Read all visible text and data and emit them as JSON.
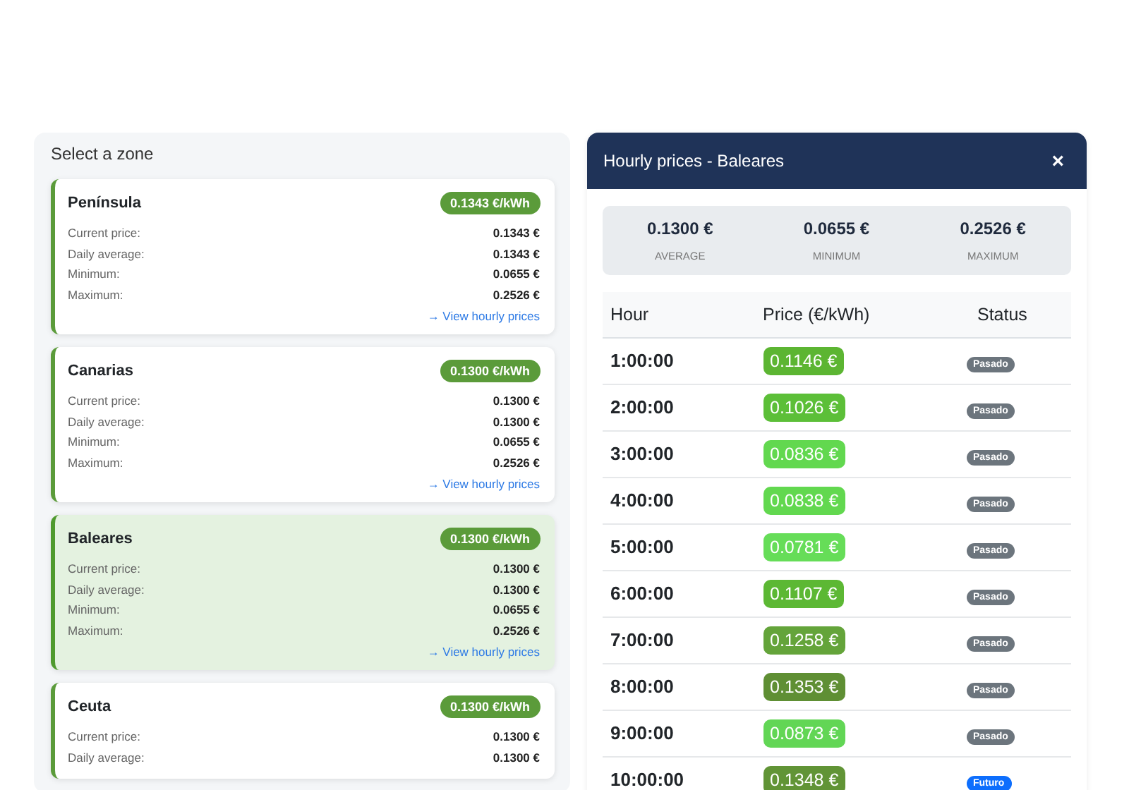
{
  "zones": {
    "title": "Select a zone",
    "cards": [
      {
        "name": "Península",
        "badge": "0.1343 €/kWh",
        "selected": false,
        "rows": [
          {
            "label": "Current price:",
            "value": "0.1343 €"
          },
          {
            "label": "Daily average:",
            "value": "0.1343 €"
          },
          {
            "label": "Minimum:",
            "value": "0.0655 €"
          },
          {
            "label": "Maximum:",
            "value": "0.2526 €"
          }
        ],
        "link": "→ View hourly prices"
      },
      {
        "name": "Canarias",
        "badge": "0.1300 €/kWh",
        "selected": false,
        "rows": [
          {
            "label": "Current price:",
            "value": "0.1300 €"
          },
          {
            "label": "Daily average:",
            "value": "0.1300 €"
          },
          {
            "label": "Minimum:",
            "value": "0.0655 €"
          },
          {
            "label": "Maximum:",
            "value": "0.2526 €"
          }
        ],
        "link": "→ View hourly prices"
      },
      {
        "name": "Baleares",
        "badge": "0.1300 €/kWh",
        "selected": true,
        "rows": [
          {
            "label": "Current price:",
            "value": "0.1300 €"
          },
          {
            "label": "Daily average:",
            "value": "0.1300 €"
          },
          {
            "label": "Minimum:",
            "value": "0.0655 €"
          },
          {
            "label": "Maximum:",
            "value": "0.2526 €"
          }
        ],
        "link": "→ View hourly prices"
      },
      {
        "name": "Ceuta",
        "badge": "0.1300 €/kWh",
        "selected": false,
        "rows": [
          {
            "label": "Current price:",
            "value": "0.1300 €"
          },
          {
            "label": "Daily average:",
            "value": "0.1300 €"
          }
        ]
      }
    ]
  },
  "modal": {
    "title": "Hourly prices - Baleares",
    "close": "×",
    "stats": [
      {
        "value": "0.1300 €",
        "label": "AVERAGE"
      },
      {
        "value": "0.0655 €",
        "label": "MINIMUM"
      },
      {
        "value": "0.2526 €",
        "label": "MAXIMUM"
      }
    ],
    "columns": [
      "Hour",
      "Price (€/kWh)",
      "Status"
    ],
    "rows": [
      {
        "hour": "1:00:00",
        "price": "0.1146 €",
        "color": "#5cb532",
        "status": "Pasado",
        "kind": "past"
      },
      {
        "hour": "2:00:00",
        "price": "0.1026 €",
        "color": "#5cbf38",
        "status": "Pasado",
        "kind": "past"
      },
      {
        "hour": "3:00:00",
        "price": "0.0836 €",
        "color": "#62d84f",
        "status": "Pasado",
        "kind": "past"
      },
      {
        "hour": "4:00:00",
        "price": "0.0838 €",
        "color": "#62d84f",
        "status": "Pasado",
        "kind": "past"
      },
      {
        "hour": "5:00:00",
        "price": "0.0781 €",
        "color": "#66dd58",
        "status": "Pasado",
        "kind": "past"
      },
      {
        "hour": "6:00:00",
        "price": "0.1107 €",
        "color": "#5cb834",
        "status": "Pasado",
        "kind": "past"
      },
      {
        "hour": "7:00:00",
        "price": "0.1258 €",
        "color": "#64a43a",
        "status": "Pasado",
        "kind": "past"
      },
      {
        "hour": "8:00:00",
        "price": "0.1353 €",
        "color": "#5f8f34",
        "status": "Pasado",
        "kind": "past"
      },
      {
        "hour": "9:00:00",
        "price": "0.0873 €",
        "color": "#62d655",
        "status": "Pasado",
        "kind": "past"
      },
      {
        "hour": "10:00:00",
        "price": "0.1348 €",
        "color": "#619436",
        "status": "Futuro",
        "kind": "future"
      }
    ]
  }
}
